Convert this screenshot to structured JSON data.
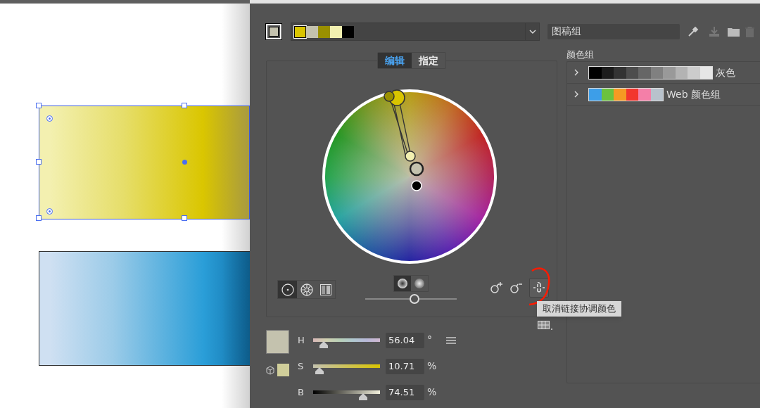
{
  "current_color": {
    "color": "#c4c2ae"
  },
  "color_bar": {
    "swatches": [
      {
        "color": "#d9c400",
        "selected": true
      },
      {
        "color": "#c4c2ae",
        "selected": false
      },
      {
        "color": "#9a9000",
        "selected": false
      },
      {
        "color": "#f2f0b0",
        "selected": false
      },
      {
        "color": "#000000",
        "selected": false
      }
    ]
  },
  "name_field": {
    "value": "图稿组"
  },
  "tabs": [
    {
      "label": "编辑",
      "selected": true
    },
    {
      "label": "指定",
      "selected": false
    }
  ],
  "view_buttons": [
    {
      "kind": "smooth",
      "selected": true
    },
    {
      "kind": "segmented",
      "selected": false
    },
    {
      "kind": "bars",
      "selected": false
    }
  ],
  "display_buttons": [
    {
      "kind": "brightness",
      "selected": true
    },
    {
      "kind": "saturation",
      "selected": false
    }
  ],
  "wheel_slider": {
    "level": 0.54
  },
  "link_button": {
    "selected": true
  },
  "tooltip": "取消链接协调颜色",
  "hsb": [
    {
      "kind": "hue",
      "label": "H",
      "level": 0.16,
      "value": "56.04",
      "unit": "°"
    },
    {
      "kind": "saturation",
      "label": "S",
      "level": 0.09,
      "value": "10.71",
      "unit": "%"
    },
    {
      "kind": "brightness",
      "label": "B",
      "level": 0.75,
      "value": "74.51",
      "unit": "%"
    }
  ],
  "color_groups": {
    "title": "颜色组",
    "items": [
      {
        "name": "灰色",
        "expanded": false,
        "swatches": [
          {
            "color": "#000000"
          },
          {
            "color": "#1c1c1c"
          },
          {
            "color": "#333333"
          },
          {
            "color": "#4d4d4d"
          },
          {
            "color": "#666666"
          },
          {
            "color": "#808080"
          },
          {
            "color": "#999999"
          },
          {
            "color": "#b3b3b3"
          },
          {
            "color": "#cccccc"
          },
          {
            "color": "#e6e6e6"
          }
        ]
      },
      {
        "name": "Web 颜色组",
        "expanded": false,
        "swatches": [
          {
            "color": "#3d9ee8"
          },
          {
            "color": "#6bc23f"
          },
          {
            "color": "#f59a23"
          },
          {
            "color": "#f2362e"
          },
          {
            "color": "#f47fa8"
          },
          {
            "color": "#b8c2cc"
          }
        ]
      }
    ]
  }
}
